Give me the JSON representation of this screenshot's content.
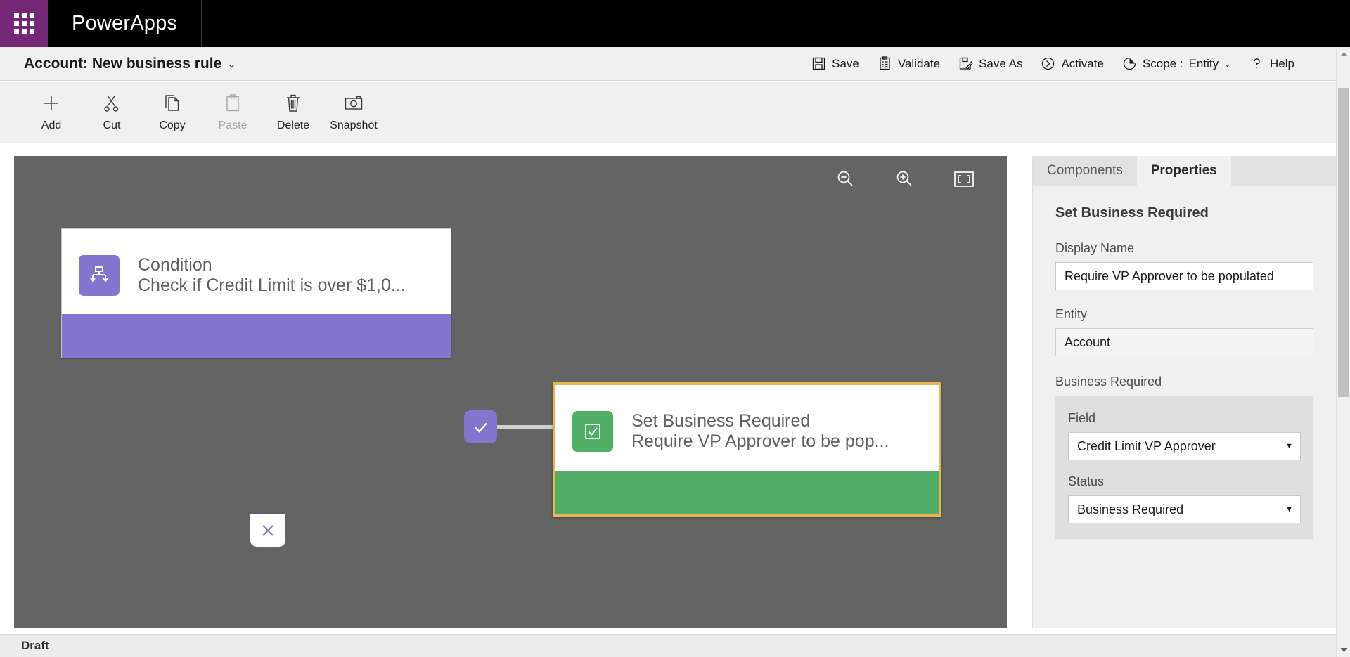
{
  "suite": {
    "waffle_label": "app-launcher",
    "brand": "PowerApps"
  },
  "command_bar": {
    "title": "Account: New business rule",
    "title_chevron": "⌄",
    "actions": [
      {
        "id": "save",
        "label": "Save",
        "icon": "save-icon",
        "enabled": true
      },
      {
        "id": "validate",
        "label": "Validate",
        "icon": "validate-icon",
        "enabled": true
      },
      {
        "id": "saveas",
        "label": "Save As",
        "icon": "save-as-icon",
        "enabled": true
      },
      {
        "id": "activate",
        "label": "Activate",
        "icon": "activate-icon",
        "enabled": true
      }
    ],
    "scope": {
      "label": "Scope :",
      "value": "Entity",
      "chevron": "⌄",
      "icon": "scope-clock-icon"
    },
    "help": {
      "label": "Help",
      "icon": "question-mark-icon"
    }
  },
  "ribbon": {
    "tools": [
      {
        "id": "add",
        "label": "Add",
        "icon": "plus-icon",
        "enabled": true
      },
      {
        "id": "cut",
        "label": "Cut",
        "icon": "scissors-icon",
        "enabled": true
      },
      {
        "id": "copy",
        "label": "Copy",
        "icon": "copy-icon",
        "enabled": true
      },
      {
        "id": "paste",
        "label": "Paste",
        "icon": "clipboard-icon",
        "enabled": false
      },
      {
        "id": "delete",
        "label": "Delete",
        "icon": "trash-icon",
        "enabled": true
      },
      {
        "id": "snapshot",
        "label": "Snapshot",
        "icon": "camera-icon",
        "enabled": true
      }
    ]
  },
  "canvas": {
    "background_color": "#646464",
    "zoom_controls": [
      {
        "id": "zoom-out",
        "icon": "zoom-out-icon"
      },
      {
        "id": "zoom-in",
        "icon": "zoom-in-icon"
      },
      {
        "id": "fit",
        "icon": "fit-to-screen-icon"
      }
    ],
    "nodes": [
      {
        "id": "condition",
        "type": "Condition",
        "title": "Condition",
        "subtitle": "Check if Credit Limit is over $1,0...",
        "icon": "branch-condition-icon",
        "color": "#8476ce",
        "selected": false
      },
      {
        "id": "set-business-required",
        "type": "Set Business Required",
        "title": "Set Business Required",
        "subtitle": "Require VP Approver to be pop...",
        "icon": "checkbox-icon",
        "color": "#51ae67",
        "selected": true,
        "selection_color": "#e8b553"
      }
    ],
    "connectors": [
      {
        "id": "true-branch",
        "glyph": "✓",
        "color": "#8476ce",
        "kind": "true"
      },
      {
        "id": "false-branch",
        "glyph": "✕",
        "color": "#8476ce",
        "kind": "false"
      }
    ]
  },
  "properties_pane": {
    "tabs": [
      {
        "id": "components",
        "label": "Components",
        "active": false
      },
      {
        "id": "properties",
        "label": "Properties",
        "active": true
      }
    ],
    "heading": "Set Business Required",
    "fields": [
      {
        "id": "display-name",
        "label": "Display Name",
        "value": "Require VP Approver to be populated",
        "readonly": false
      },
      {
        "id": "entity",
        "label": "Entity",
        "value": "Account",
        "readonly": true
      }
    ],
    "group": {
      "label": "Business Required",
      "selects": [
        {
          "id": "field",
          "label": "Field",
          "value": "Credit Limit VP Approver",
          "arrow": "▼"
        },
        {
          "id": "status",
          "label": "Status",
          "value": "Business Required",
          "arrow": "▼"
        }
      ]
    }
  },
  "status_bar": {
    "state": "Draft"
  },
  "scrollbar": {
    "up_arrow": "▲",
    "down_arrow": "▼"
  }
}
